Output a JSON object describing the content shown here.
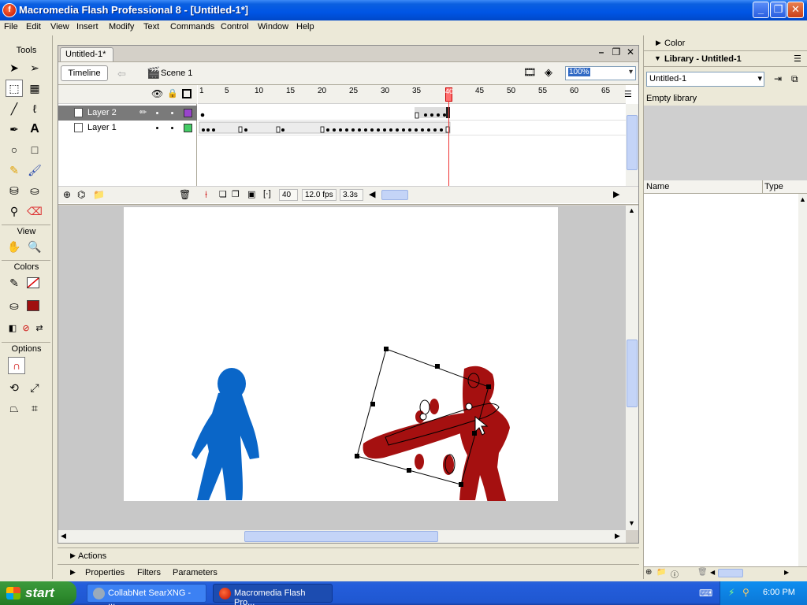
{
  "window": {
    "title": "Macromedia Flash Professional 8 - [Untitled-1*]",
    "app_icon": "flash-f-icon"
  },
  "menubar": [
    "File",
    "Edit",
    "View",
    "Insert",
    "Modify",
    "Text",
    "Commands",
    "Control",
    "Window",
    "Help"
  ],
  "tools": {
    "title": "Tools",
    "view_label": "View",
    "colors_label": "Colors",
    "options_label": "Options",
    "stroke_color": "#ffffff",
    "fill_color": "#a01010"
  },
  "document": {
    "tab_label": "Untitled-1*",
    "timeline_button": "Timeline",
    "scene_label": "Scene 1",
    "zoom_value": "100%"
  },
  "timeline": {
    "layers": [
      {
        "name": "Layer 2",
        "color": "#9944cc",
        "selected": true
      },
      {
        "name": "Layer 1",
        "color": "#44cc66",
        "selected": false
      }
    ],
    "ruler_ticks": [
      "1",
      "5",
      "10",
      "15",
      "20",
      "25",
      "30",
      "35",
      "40",
      "45",
      "50",
      "55",
      "60",
      "65"
    ],
    "current_frame": "40",
    "fps": "12.0 fps",
    "elapsed": "3.3s"
  },
  "stage": {
    "figure_blue_color": "#0a66c8",
    "figure_red_color": "#a51010"
  },
  "bottom_panels": {
    "actions": "Actions",
    "properties": "Properties",
    "filters": "Filters",
    "parameters": "Parameters"
  },
  "right_panels": {
    "color_title": "Color",
    "library_title": "Library - Untitled-1",
    "library_select": "Untitled-1",
    "empty_text": "Empty library",
    "col_name": "Name",
    "col_type": "Type"
  },
  "taskbar": {
    "start": "start",
    "tasks": [
      "CollabNet SearXNG - ...",
      "Macromedia Flash Pro..."
    ],
    "clock": "6:00 PM"
  }
}
